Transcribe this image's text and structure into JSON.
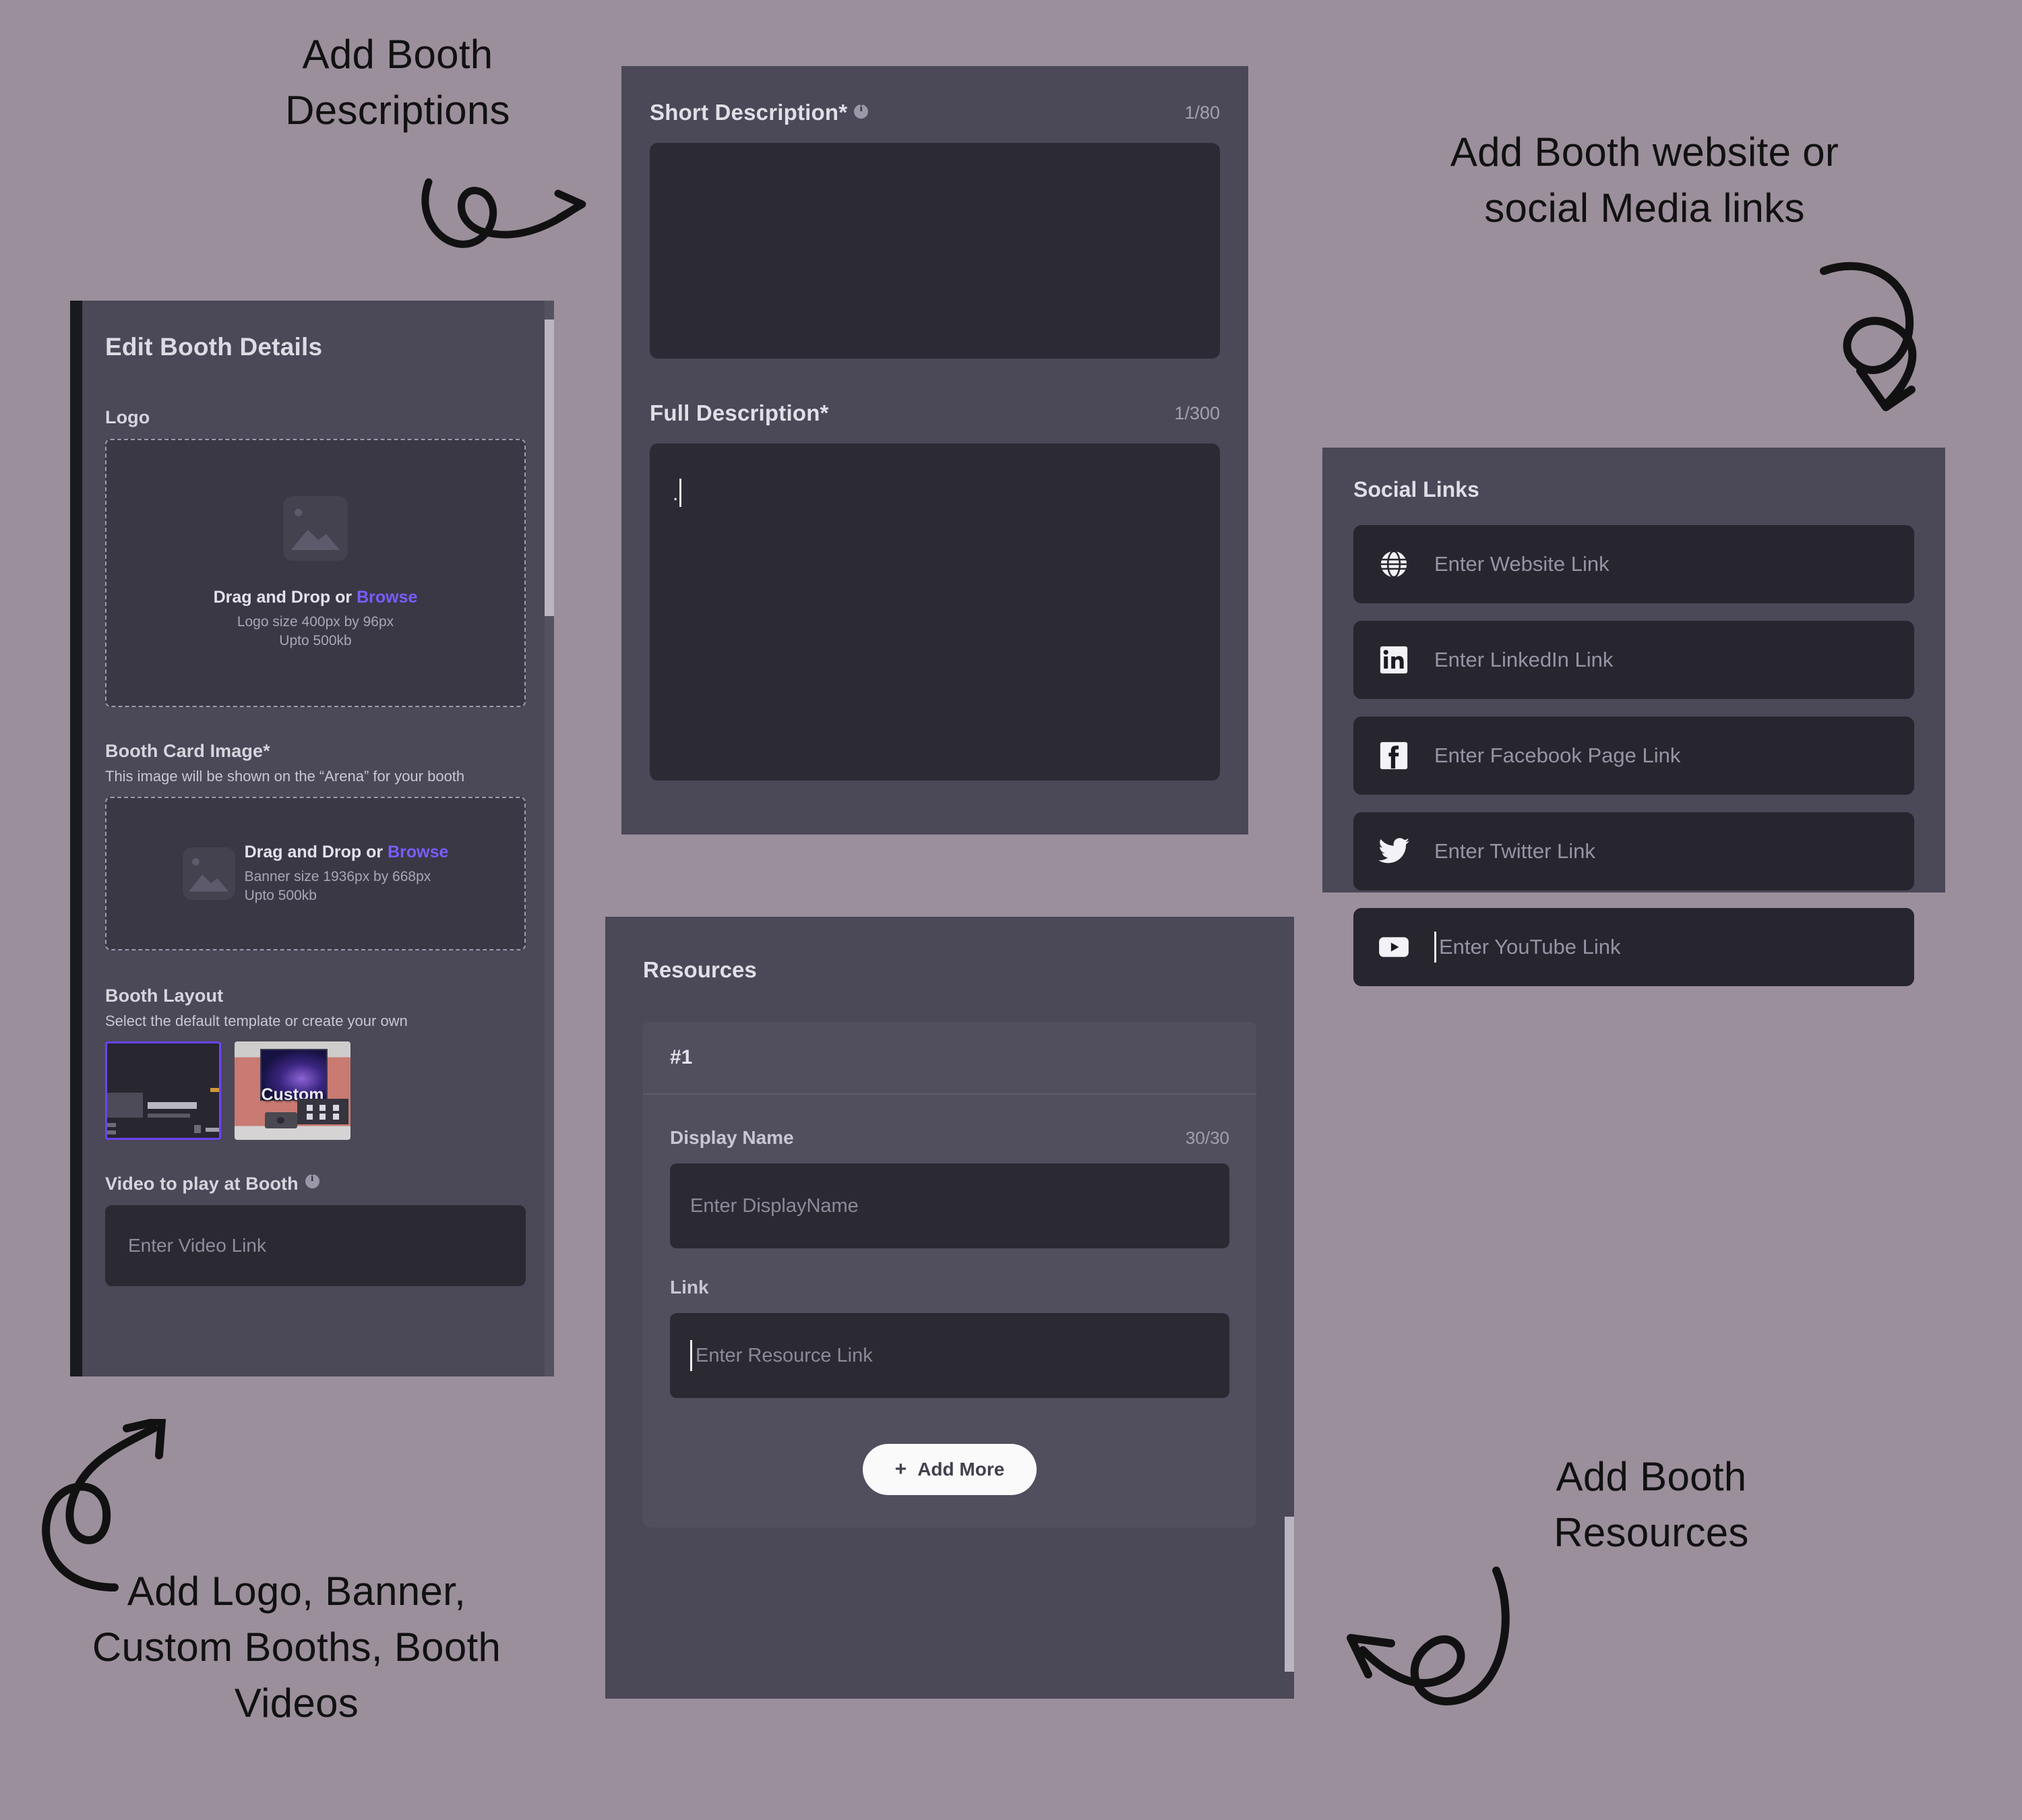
{
  "theme": {
    "background": "#9b8f9c",
    "panel_bg": "#4b4857",
    "input_bg": "#2b2932",
    "accent_purple": "#7a5cff",
    "selected_border": "#6b44ff",
    "text_primary": "#e0dfe7",
    "text_muted": "#a3a1b0"
  },
  "annotations": [
    {
      "id": "add-booth-descriptions",
      "text": "Add Booth\nDescriptions"
    },
    {
      "id": "add-booth-website",
      "text": "Add Booth website or\nsocial Media links"
    },
    {
      "id": "add-logo-banner",
      "text": "Add Logo, Banner,\nCustom Booths, Booth\nVideos"
    },
    {
      "id": "add-booth-resources",
      "text": "Add Booth\nResources"
    }
  ],
  "edit_booth_details": {
    "title": "Edit Booth Details",
    "logo": {
      "label": "Logo",
      "drop_prefix": "Drag and Drop or ",
      "browse": "Browse",
      "size_hint": "Logo size 400px by 96px",
      "limit_hint": "Upto 500kb"
    },
    "booth_card_image": {
      "label": "Booth Card Image*",
      "description": "This image will be shown on the “Arena” for your booth",
      "drop_prefix": "Drag and Drop or ",
      "browse": "Browse",
      "size_hint": "Banner size 1936px by 668px",
      "limit_hint": "Upto 500kb"
    },
    "booth_layout": {
      "label": "Booth Layout",
      "description": "Select the default template or create your own",
      "options": [
        {
          "name": "default-template",
          "label": "",
          "selected": true
        },
        {
          "name": "custom-template",
          "label": "Custom",
          "selected": false
        }
      ]
    },
    "video": {
      "label": "Video to play at Booth",
      "placeholder": "Enter Video Link",
      "value": ""
    }
  },
  "descriptions": {
    "short": {
      "label": "Short Description*",
      "counter": "1/80",
      "value": "",
      "has_info_icon": true
    },
    "full": {
      "label": "Full Description*",
      "counter": "1/300",
      "value": ".",
      "has_cursor": true
    }
  },
  "resources": {
    "title": "Resources",
    "items": [
      {
        "index_label": "#1",
        "display_name": {
          "label": "Display Name",
          "counter": "30/30",
          "placeholder": "Enter DisplayName",
          "value": ""
        },
        "link": {
          "label": "Link",
          "placeholder": "Enter Resource Link",
          "value": "",
          "has_cursor": true
        }
      }
    ],
    "add_more_label": "Add More",
    "add_more_plus": "+"
  },
  "social_links": {
    "title": "Social Links",
    "rows": [
      {
        "icon": "globe-icon",
        "placeholder": "Enter Website Link",
        "value": "",
        "has_cursor": false
      },
      {
        "icon": "linkedin-icon",
        "placeholder": "Enter LinkedIn Link",
        "value": "",
        "has_cursor": false
      },
      {
        "icon": "facebook-icon",
        "placeholder": "Enter Facebook Page Link",
        "value": "",
        "has_cursor": false
      },
      {
        "icon": "twitter-icon",
        "placeholder": "Enter Twitter Link",
        "value": "",
        "has_cursor": false
      },
      {
        "icon": "youtube-icon",
        "placeholder": "Enter YouTube Link",
        "value": "",
        "has_cursor": true
      }
    ]
  }
}
